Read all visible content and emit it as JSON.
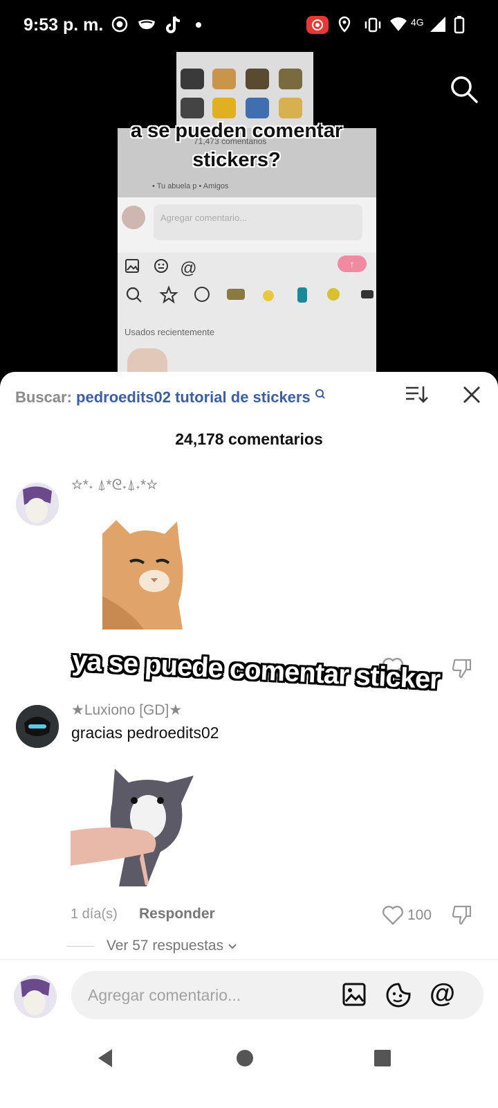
{
  "status_bar": {
    "time": "9:53 p. m.",
    "network": "4G"
  },
  "video": {
    "overlay_title": "a se pueden comentar stickers?",
    "inner_comment_count": "71,473 comentarios",
    "inner_subline": "• Tu abuela p • Amigos",
    "inner_input_placeholder": "Agregar comentario...",
    "inner_recent_label": "Usados recientemente",
    "caption": "ya se puede comentar sticker"
  },
  "sheet": {
    "search_label": "Buscar:",
    "search_query": "pedroedits02 tutorial de stickers",
    "comment_count": "24,178 comentarios",
    "comments": [
      {
        "username": "☆*˖ ⍋*ᘓ˖⍋˖*☆",
        "text": "",
        "sticker": "cat-smirk-sticker"
      },
      {
        "username": "★Luxiono [GD]★",
        "text": "gracias pedroedits02",
        "sticker": "cat-hand-sticker",
        "time": "1 día(s)",
        "reply_label": "Responder",
        "likes": "100",
        "view_replies": "Ver 57 respuestas"
      }
    ]
  },
  "bottom": {
    "placeholder": "Agregar comentario..."
  },
  "colors": {
    "link": "#3b5ea6",
    "accent_pink": "#f08aa0"
  }
}
